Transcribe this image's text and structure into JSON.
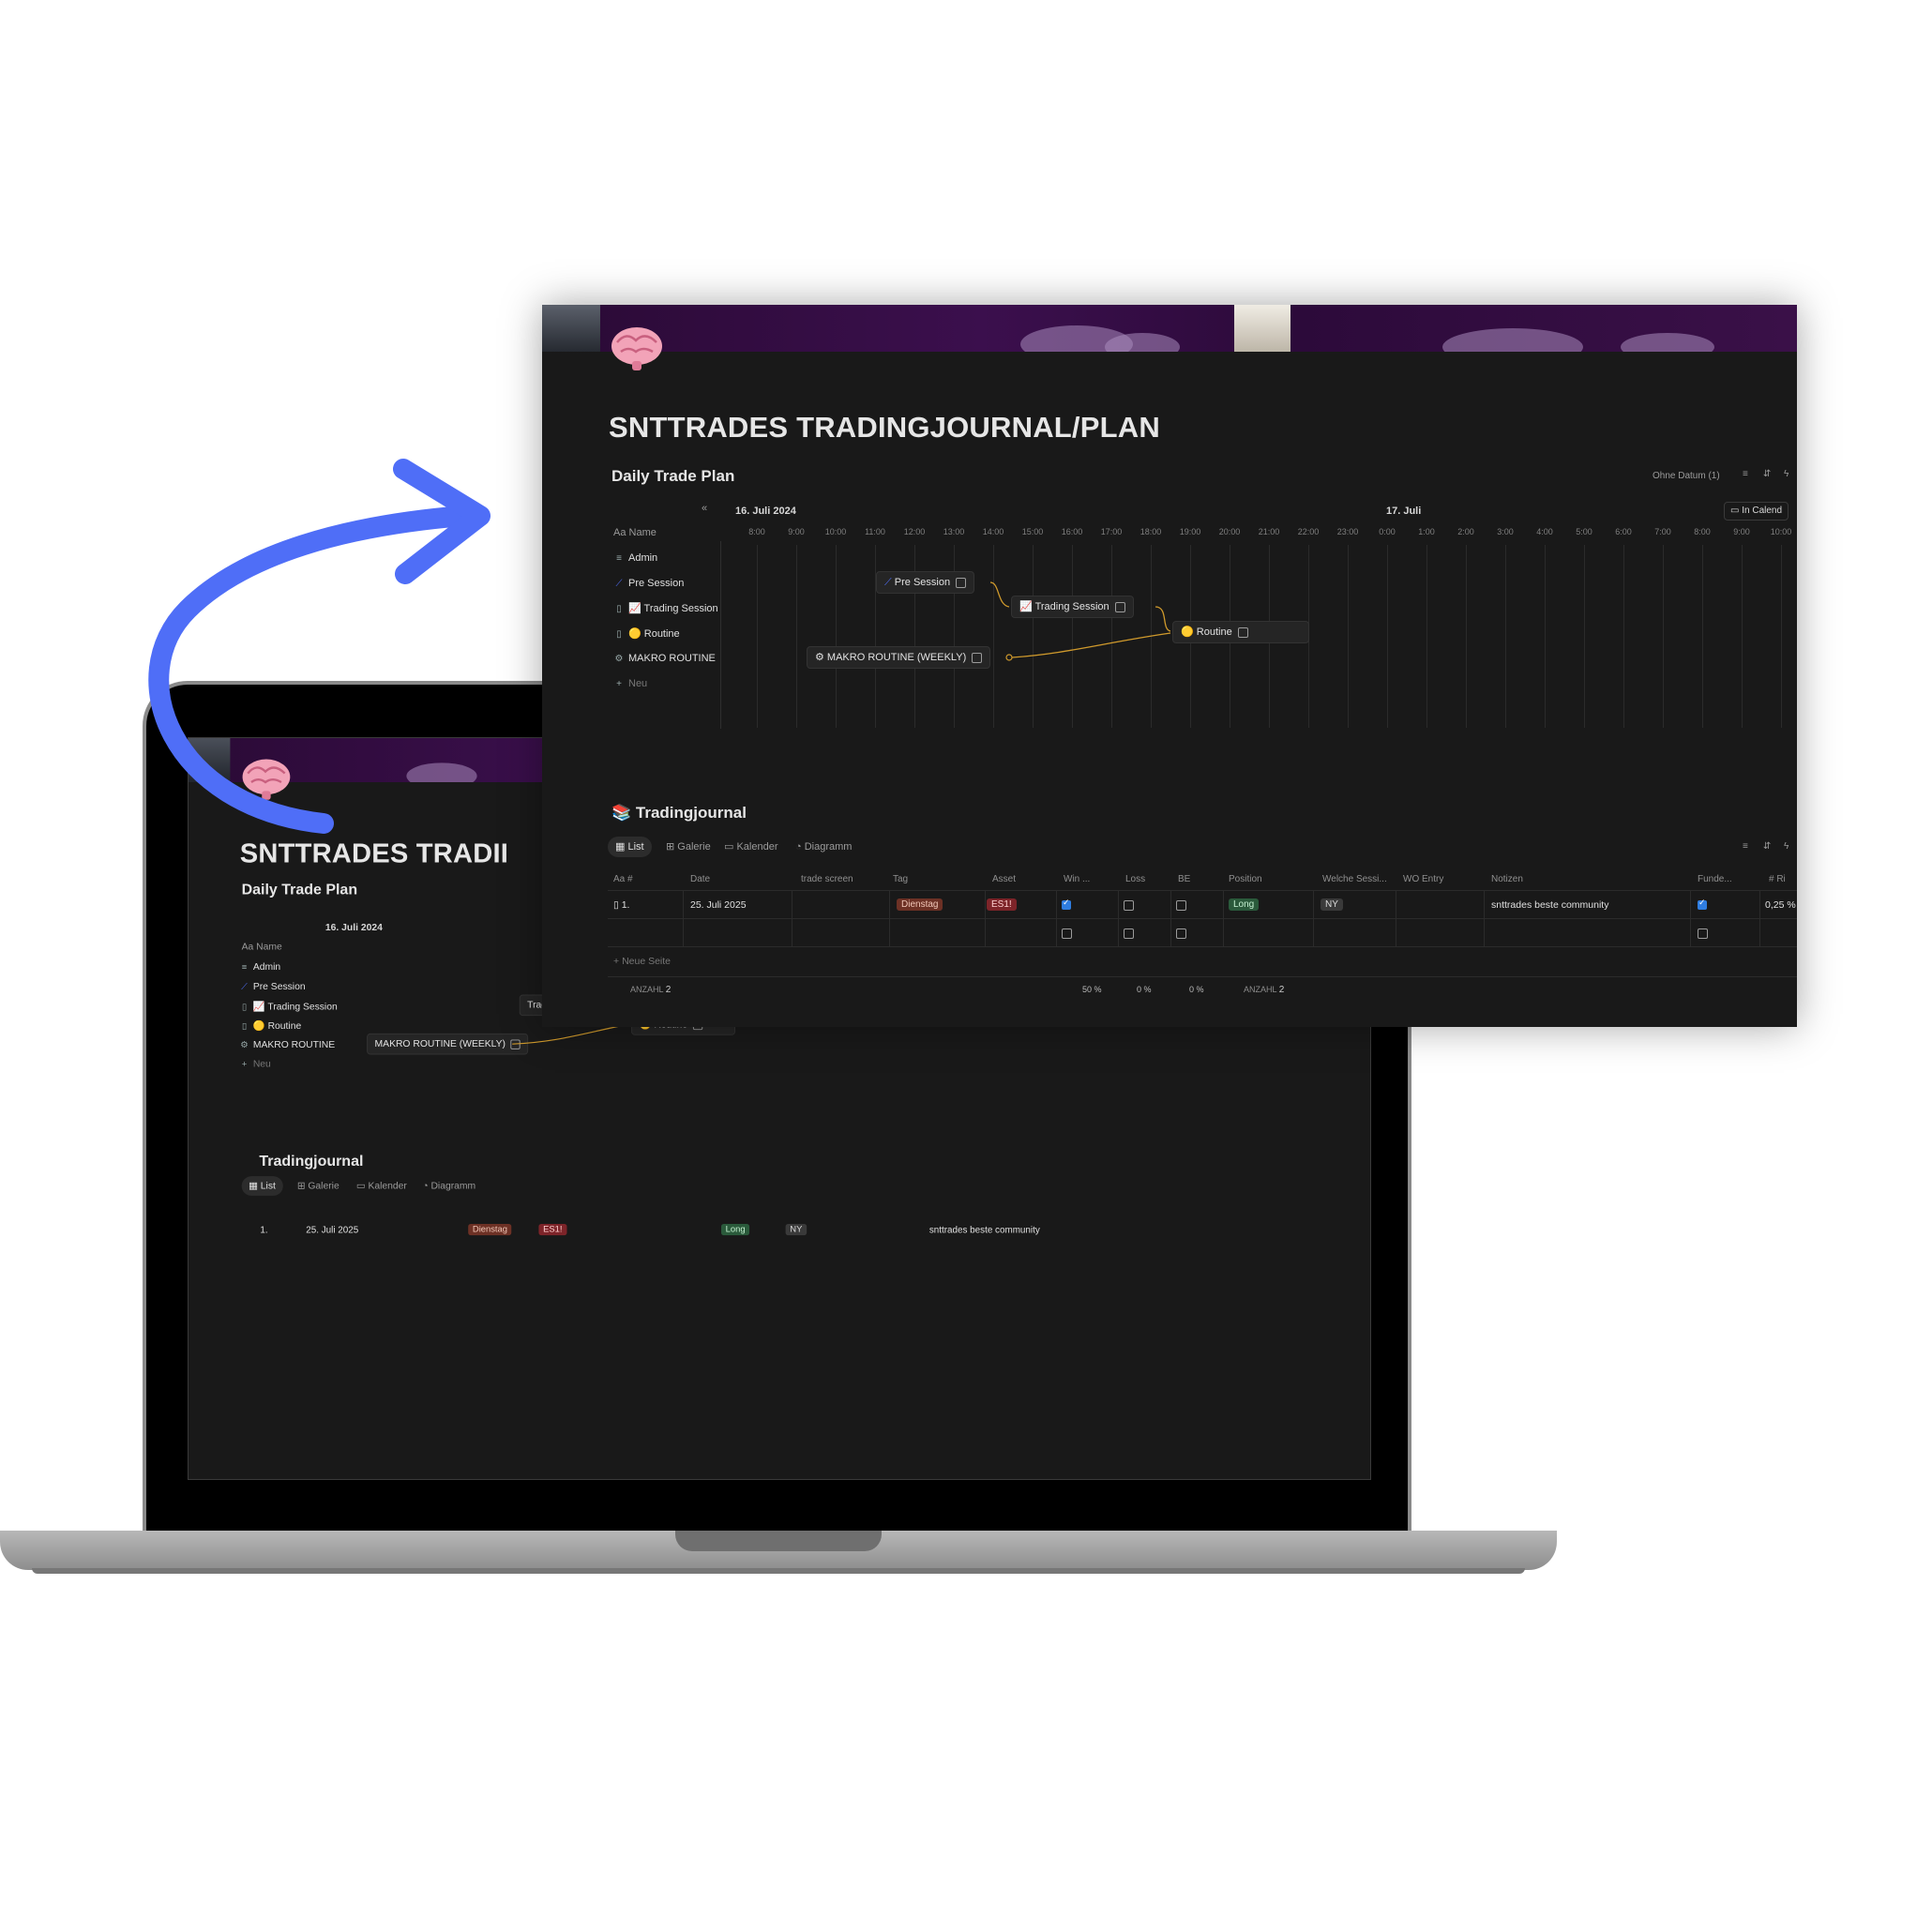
{
  "page": {
    "title": "SNTTRADES TRADINGJOURNAL/PLAN",
    "title_truncated": "SNTTRADES TRADII",
    "brand_color": "#4f6ef7"
  },
  "daily_trade_plan": {
    "title": "Daily Trade Plan",
    "toolbar": {
      "no_date": "Ohne Datum (1)",
      "calendar_button": "In Calend"
    },
    "date_left": "16. Juli 2024",
    "date_right": "17. Juli",
    "hours": [
      "8:00",
      "9:00",
      "10:00",
      "11:00",
      "12:00",
      "13:00",
      "14:00",
      "15:00",
      "16:00",
      "17:00",
      "18:00",
      "19:00",
      "20:00",
      "21:00",
      "22:00",
      "23:00",
      "0:00",
      "1:00",
      "2:00",
      "3:00",
      "4:00",
      "5:00",
      "6:00",
      "7:00",
      "8:00",
      "9:00",
      "10:00"
    ],
    "name_header": "Aa Name",
    "rows": [
      {
        "icon": "stack-icon",
        "label": "Admin"
      },
      {
        "icon": "steps-icon",
        "label": "Pre Session"
      },
      {
        "icon": "page-icon",
        "label": "📈 Trading Session"
      },
      {
        "icon": "page-icon",
        "label": "🟡 Routine"
      },
      {
        "icon": "robot-icon",
        "label": "MAKRO ROUTINE"
      }
    ],
    "new_label": "Neu",
    "cards": {
      "pre_session": "Pre Session",
      "trading_session": "Trading Session",
      "routine": "Routine",
      "makro": "MAKRO ROUTINE (WEEKLY)"
    }
  },
  "tradingjournal": {
    "title": "Tradingjournal",
    "tabs": [
      "List",
      "Galerie",
      "Kalender",
      "Diagramm"
    ],
    "columns": [
      "Aa #",
      "Date",
      "trade screen",
      "Tag",
      "Asset",
      "Win ...",
      "Loss",
      "BE",
      "Position",
      "Welche Sessi...",
      "WO Entry",
      "Notizen",
      "Funde...",
      "# Ri"
    ],
    "row": {
      "number": "1.",
      "date": "25. Juli 2025",
      "tag": "Dienstag",
      "asset": "ES1!",
      "position": "Long",
      "session": "NY",
      "notes": "snttrades beste community",
      "risk": "0,25 %"
    },
    "new_page": "Neue Seite",
    "footer": {
      "count_label": "ANZAHL",
      "count": "2",
      "win_pct": "50 %",
      "loss_pct": "0 %",
      "be_pct": "0 %",
      "count_label_2": "ANZAHL",
      "count_2": "2"
    }
  }
}
